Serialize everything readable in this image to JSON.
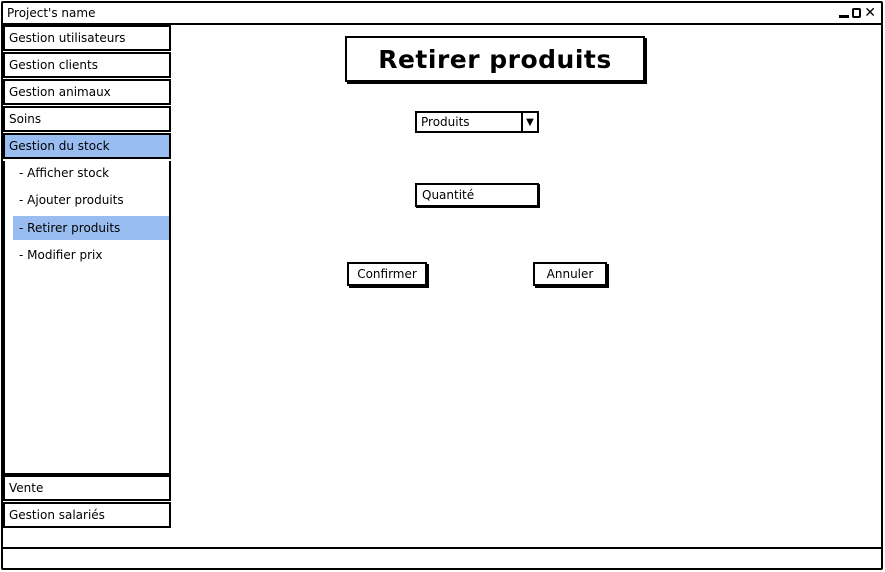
{
  "window": {
    "title": "Project's name",
    "close_glyph": "✕",
    "controls": [
      "minimize-icon",
      "maximize-icon",
      "close-icon"
    ]
  },
  "sidebar": {
    "items": [
      {
        "label": "Gestion utilisateurs",
        "active": false
      },
      {
        "label": "Gestion clients",
        "active": false
      },
      {
        "label": "Gestion animaux",
        "active": false
      },
      {
        "label": "Soins",
        "active": false
      },
      {
        "label": "Gestion du stock",
        "active": true
      }
    ],
    "submenu": [
      {
        "label": "- Afficher stock",
        "active": false
      },
      {
        "label": "- Ajouter produits",
        "active": false
      },
      {
        "label": "- Retirer produits",
        "active": true
      },
      {
        "label": "- Modifier prix",
        "active": false
      }
    ],
    "bottom_items": [
      {
        "label": "Vente",
        "active": false
      },
      {
        "label": "Gestion salariés",
        "active": false
      }
    ]
  },
  "main": {
    "title": "Retirer produits",
    "product_select": {
      "value": "Produits",
      "arrow": "▼"
    },
    "quantity_field": {
      "placeholder": "Quantité"
    },
    "confirm_label": "Confirmer",
    "cancel_label": "Annuler"
  },
  "colors": {
    "highlight": "#99bdf0",
    "border": "#000000",
    "background": "#ffffff"
  }
}
